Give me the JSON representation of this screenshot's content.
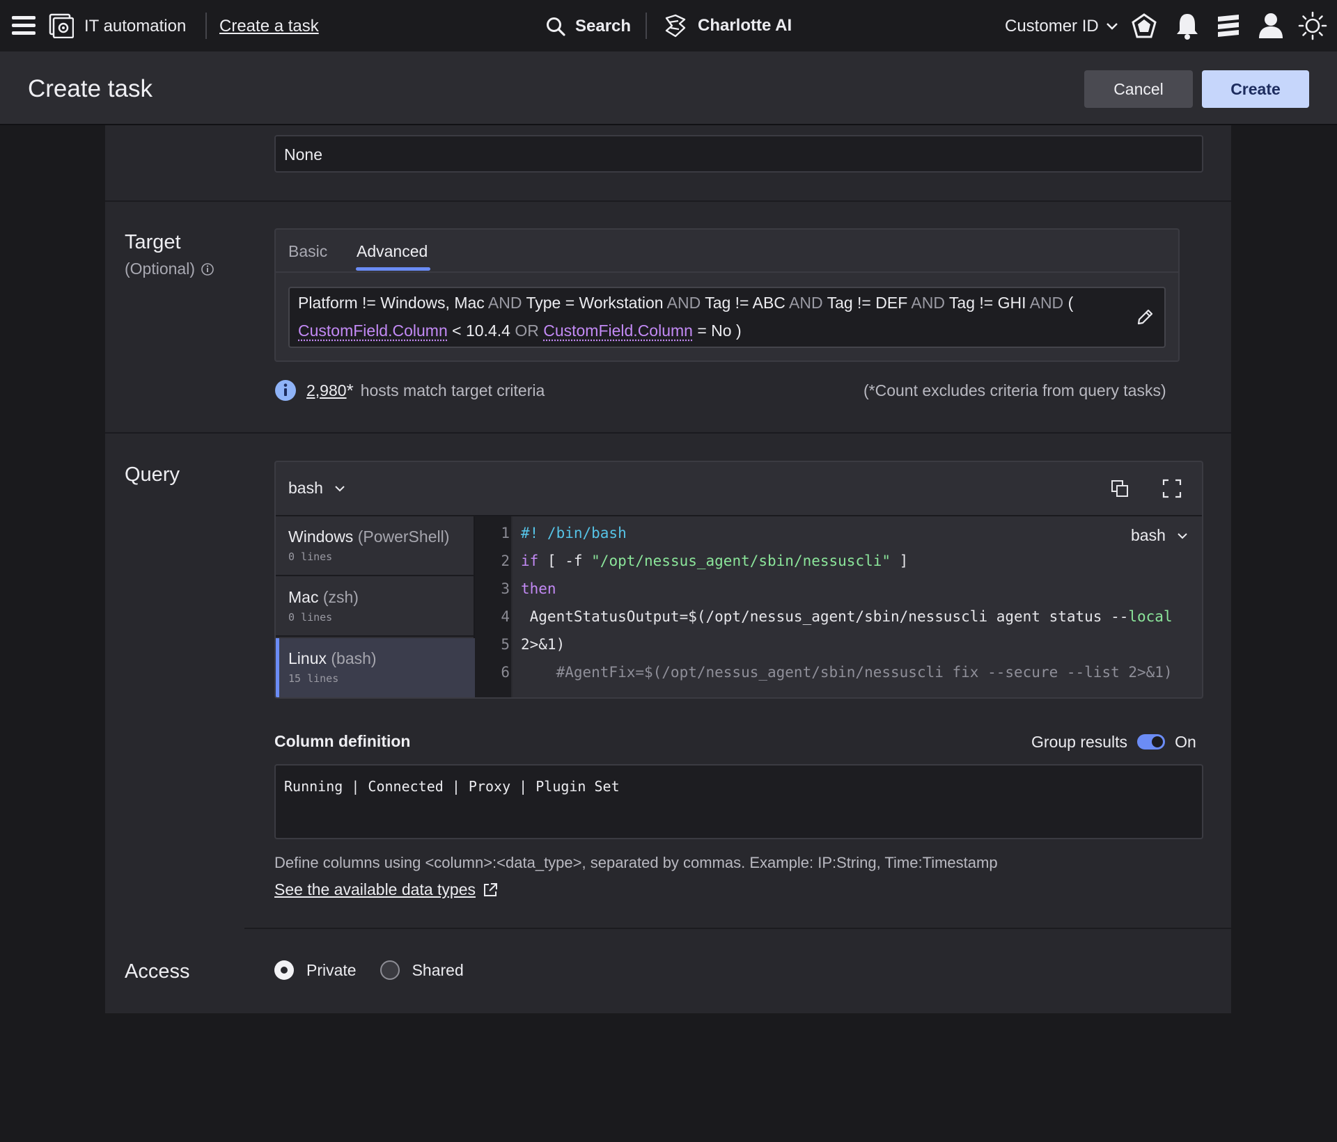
{
  "nav": {
    "app_name": "IT automation",
    "breadcrumb_link": "Create a task",
    "search_label": "Search",
    "ai_label": "Charlotte AI",
    "customer_select": "Customer ID"
  },
  "header": {
    "title": "Create task",
    "cancel_label": "Cancel",
    "create_label": "Create"
  },
  "top_field": {
    "value": "None"
  },
  "target": {
    "label": "Target",
    "optional": "(Optional)",
    "tabs": [
      {
        "label": "Basic",
        "active": false
      },
      {
        "label": "Advanced",
        "active": true
      }
    ],
    "query_line1": [
      {
        "t": "Platform != Windows, Mac",
        "k": "v"
      },
      {
        "t": " AND ",
        "k": "kw"
      },
      {
        "t": "Type = Workstation",
        "k": "v"
      },
      {
        "t": " AND ",
        "k": "kw"
      },
      {
        "t": "Tag != ABC",
        "k": "v"
      },
      {
        "t": " AND ",
        "k": "kw"
      },
      {
        "t": "Tag != DEF",
        "k": "v"
      },
      {
        "t": " AND ",
        "k": "kw"
      },
      {
        "t": "Tag != GHI",
        "k": "v"
      },
      {
        "t": " AND ",
        "k": "kw"
      },
      {
        "t": "(",
        "k": "v"
      }
    ],
    "query_line2": [
      {
        "t": "CustomField.Column",
        "k": "link"
      },
      {
        "t": " < 10.4.4 ",
        "k": "v"
      },
      {
        "t": "OR",
        "k": "kw"
      },
      {
        "t": " ",
        "k": "v"
      },
      {
        "t": "CustomField.Column",
        "k": "link"
      },
      {
        "t": " = No )",
        "k": "v"
      }
    ],
    "host_count": "2,980",
    "host_count_mark": "*",
    "host_text": "hosts match target criteria",
    "count_note": "(*Count excludes criteria from query tasks)"
  },
  "query": {
    "label": "Query",
    "language_select": "bash",
    "editor_language": "bash",
    "os_list": [
      {
        "name": "Windows",
        "shell": "(PowerShell)",
        "lines": "0 lines",
        "active": false
      },
      {
        "name": "Mac",
        "shell": "(zsh)",
        "lines": "0 lines",
        "active": false
      },
      {
        "name": "Linux",
        "shell": "(bash)",
        "lines": "15 lines",
        "active": true
      }
    ],
    "code": [
      {
        "n": "1",
        "parts": [
          {
            "t": "#! /bin/bash",
            "c": "cyan"
          }
        ]
      },
      {
        "n": "2",
        "parts": [
          {
            "t": "if",
            "c": "purple"
          },
          {
            "t": " [ -f ",
            "c": "white"
          },
          {
            "t": "\"/opt/nessus_agent/sbin/nessuscli\"",
            "c": "green"
          },
          {
            "t": " ]",
            "c": "white"
          }
        ]
      },
      {
        "n": "3",
        "parts": [
          {
            "t": "then",
            "c": "purple"
          }
        ]
      },
      {
        "n": "4",
        "parts": [
          {
            "t": " AgentStatusOutput=$(/opt/nessus_agent/sbin/nessuscli agent status --",
            "c": "white"
          },
          {
            "t": "local",
            "c": "green"
          }
        ]
      },
      {
        "n": "5",
        "parts": [
          {
            "t": "2>&1)",
            "c": "white"
          }
        ]
      },
      {
        "n": "6",
        "parts": [
          {
            "t": "    #AgentFix=$(/opt/nessus_agent/sbin/nessuscli fix --secure --list 2>&1)",
            "c": "gray"
          }
        ]
      }
    ]
  },
  "columns": {
    "label": "Column definition",
    "group_label": "Group results",
    "group_state": "On",
    "value": "Running | Connected | Proxy | Plugin Set",
    "help": "Define columns using <column>:<data_type>, separated by commas. Example: IP:String, Time:Timestamp",
    "help_link": "See the available data types"
  },
  "access": {
    "label": "Access",
    "options": [
      {
        "label": "Private",
        "checked": true
      },
      {
        "label": "Shared",
        "checked": false
      }
    ]
  },
  "colors": {
    "accent": "#6b8cf5",
    "purple_link": "#c38af5",
    "code_cyan": "#56c3e6",
    "code_green": "#8be59a"
  }
}
